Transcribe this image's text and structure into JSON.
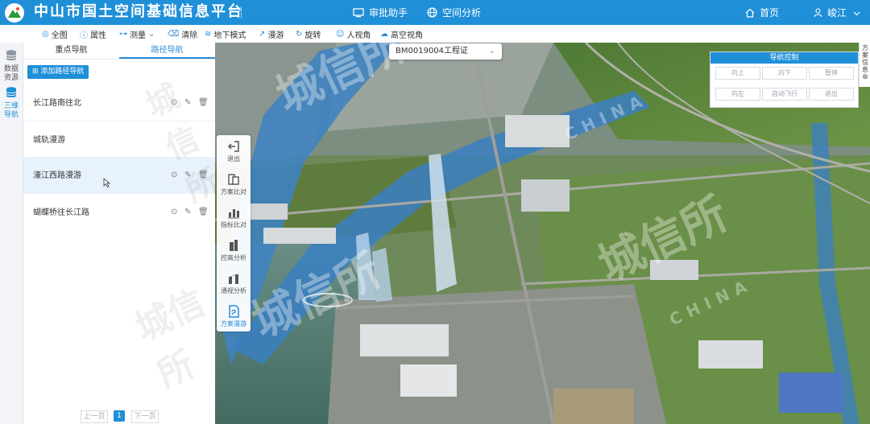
{
  "header": {
    "title": "中山市国土空间基础信息平台",
    "nav": [
      {
        "label": "审批助手",
        "icon": "monitor-icon"
      },
      {
        "label": "空间分析",
        "icon": "globe-icon"
      }
    ],
    "home_label": "首页",
    "user_name": "峻江"
  },
  "toolbar": [
    {
      "label": "全图",
      "icon": "globe-icon"
    },
    {
      "label": "属性",
      "icon": "info-icon"
    },
    {
      "label": "测量",
      "icon": "ruler-icon"
    },
    {
      "label": "清除",
      "icon": "trash-icon"
    },
    {
      "label": "地下模式",
      "icon": "layers-icon"
    },
    {
      "label": "漫游",
      "icon": "walk-icon"
    },
    {
      "label": "旋转",
      "icon": "rotate-icon"
    },
    {
      "label": "人视角",
      "icon": "person-icon"
    },
    {
      "label": "高空视角",
      "icon": "sky-icon"
    }
  ],
  "left_rail": [
    {
      "label_1": "数据",
      "label_2": "资源",
      "icon": "database-icon"
    },
    {
      "label_1": "三维",
      "label_2": "导航",
      "icon": "database-icon"
    }
  ],
  "panel": {
    "tabs": [
      "重点导航",
      "路径导航"
    ],
    "active_tab": "路径导航",
    "add_button": "添加路径导航",
    "routes": [
      "长江路南往北",
      "城轨漫游",
      "濠江西路漫游",
      "蝴蝶桥往长江路"
    ],
    "selected_route": "濠江西路漫游",
    "pager": {
      "prev": "上一页",
      "current": "1",
      "next": "下一页"
    }
  },
  "map": {
    "scheme_select": "BM0019004工程证",
    "tools": [
      "退出",
      "方案比对",
      "指标比对",
      "控高分析",
      "通视分析",
      "方案漫游"
    ],
    "nav_control": {
      "title": "导航控制",
      "row1": [
        "向上",
        "向下",
        "暂停"
      ],
      "row2": [
        "向左",
        "自动飞行",
        "退出"
      ]
    },
    "right_panel_label": "方案信息",
    "watermark": "城信所",
    "watermark_en": "CHINA"
  }
}
